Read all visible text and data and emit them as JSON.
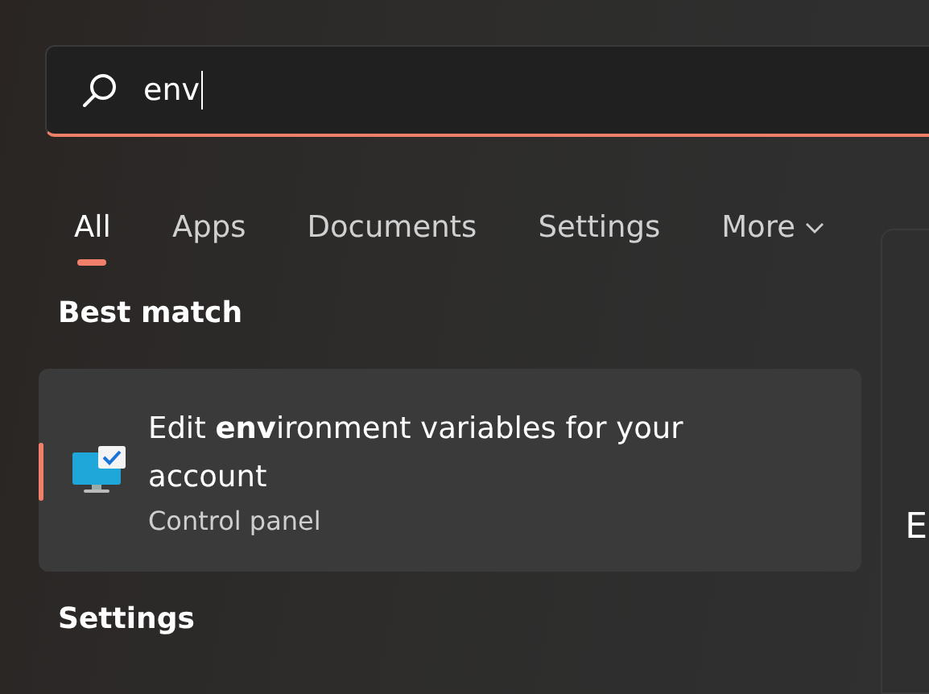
{
  "search": {
    "value": "env"
  },
  "tabs": [
    {
      "label": "All",
      "selected": true,
      "dropdown": false
    },
    {
      "label": "Apps",
      "selected": false,
      "dropdown": false
    },
    {
      "label": "Documents",
      "selected": false,
      "dropdown": false
    },
    {
      "label": "Settings",
      "selected": false,
      "dropdown": false
    },
    {
      "label": "More",
      "selected": false,
      "dropdown": true
    }
  ],
  "best_match": {
    "heading": "Best match",
    "result": {
      "title": "Edit **env**ironment variables for your account",
      "subtitle": "Control panel",
      "selected": true
    }
  },
  "settings": {
    "heading": "Settings"
  },
  "preview_panel": {
    "title": "E"
  }
}
